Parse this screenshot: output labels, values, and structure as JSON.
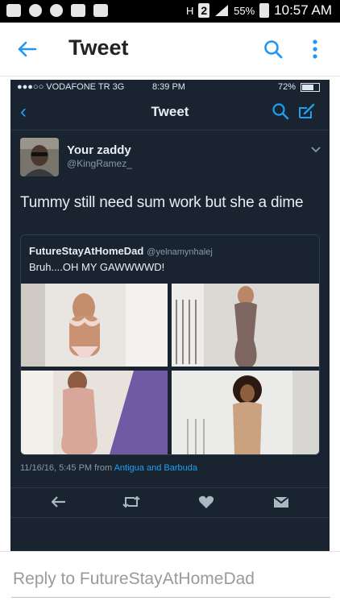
{
  "status_bar": {
    "signal_label": "H",
    "sim_label": "2",
    "battery_percent": "55%",
    "time": "10:57 AM"
  },
  "app_bar": {
    "title": "Tweet"
  },
  "inner_status": {
    "carrier": "●●●○○ VODAFONE TR  3G",
    "time": "8:39 PM",
    "battery": "72%"
  },
  "inner_nav": {
    "back": "‹",
    "title": "Tweet"
  },
  "tweet": {
    "author_name": "Your zaddy",
    "author_handle": "@KingRamez_",
    "text": "Tummy still need sum work but she a dime",
    "quoted": {
      "author_name": "FutureStayAtHomeDad",
      "author_handle": "@yelnamynhalej",
      "text": "Bruh....OH MY GAWWWWD!"
    },
    "date": "11/16/16, 5:45 PM from",
    "location": "Antigua and Barbuda"
  },
  "reply_bar": {
    "placeholder": "Reply to FutureStayAtHomeDad"
  },
  "colors": {
    "twitter_blue": "#1da1f2",
    "dark_bg": "#1a2430",
    "android_blue": "#2196f3"
  }
}
